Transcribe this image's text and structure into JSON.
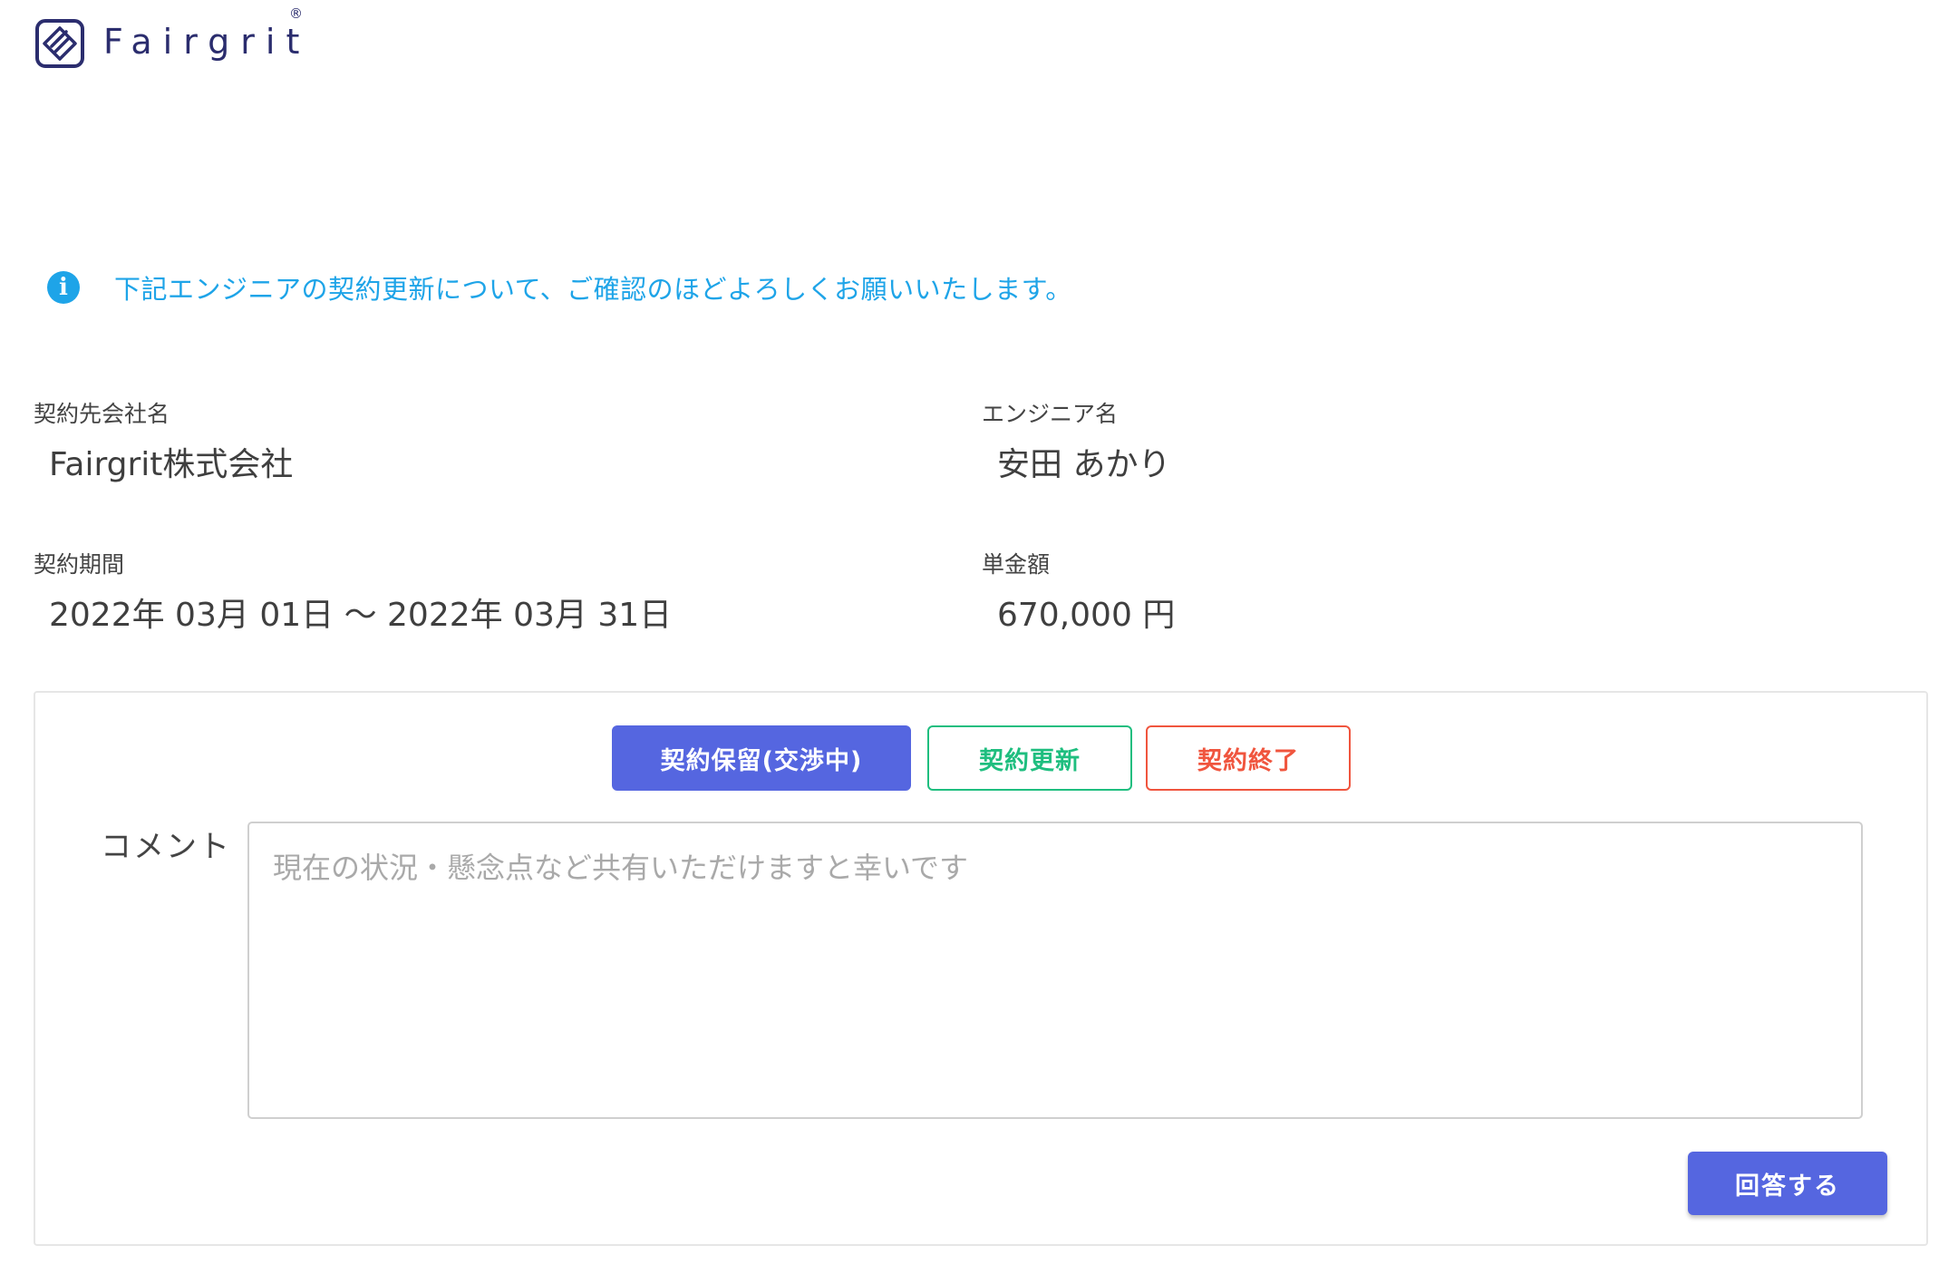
{
  "brand": {
    "name": "Fairgrit",
    "registered_mark": "®",
    "color": "#2b2d6e"
  },
  "notice": {
    "icon": "info-icon",
    "text": "下記エンジニアの契約更新について、ご確認のほどよろしくお願いいたします。",
    "color": "#1ea4e8"
  },
  "contract": {
    "company_label": "契約先会社名",
    "company_value": "Fairgrit株式会社",
    "engineer_label": "エンジニア名",
    "engineer_value": "安田 あかり",
    "period_label": "契約期間",
    "period_value": "2022年 03月 01日 ～ 2022年 03月 31日",
    "rate_label": "単金額",
    "rate_value": "670,000 円"
  },
  "response": {
    "status_options": [
      {
        "label": "契約保留(交渉中)",
        "selected": true,
        "color": "#5566e0"
      },
      {
        "label": "契約更新",
        "selected": false,
        "color": "#1fbe7f"
      },
      {
        "label": "契約終了",
        "selected": false,
        "color": "#f0553e"
      }
    ],
    "comment_label": "コメント",
    "comment_placeholder": "現在の状況・懸念点など共有いただけますと幸いです",
    "comment_value": "",
    "submit_label": "回答する"
  }
}
